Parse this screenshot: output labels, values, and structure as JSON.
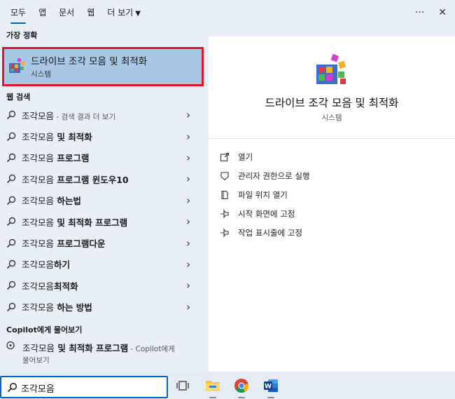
{
  "tabs": [
    {
      "label": "모두",
      "active": true
    },
    {
      "label": "앱"
    },
    {
      "label": "문서"
    },
    {
      "label": "웹"
    },
    {
      "label": "더 보기"
    }
  ],
  "top_right": {
    "more": "···",
    "close": "✕"
  },
  "best_match": {
    "section": "가장 정확",
    "title": "드라이브 조각 모음 및 최적화",
    "subtitle": "시스템"
  },
  "web_search": {
    "section": "웹 검색",
    "items": [
      {
        "query": "조각모음",
        "suffix": " - 검색 결과 더 보기",
        "bold": ""
      },
      {
        "query": "조각모음",
        "bold": " 및 최적화"
      },
      {
        "query": "조각모음",
        "bold": " 프로그램"
      },
      {
        "query": "조각모음",
        "bold": " 프로그램 윈도우10"
      },
      {
        "query": "조각모음",
        "bold": " 하는법"
      },
      {
        "query": "조각모음",
        "bold": " 및 최적화 프로그램"
      },
      {
        "query": "조각모음",
        "bold": " 프로그램다운"
      },
      {
        "query": "조각모음",
        "bold": "하기"
      },
      {
        "query": "조각모음",
        "bold": "최적화"
      },
      {
        "query": "조각모음",
        "bold": " 하는 방법"
      }
    ]
  },
  "copilot": {
    "section": "Copilot에게 물어보기",
    "query": "조각모음",
    "bold": " 및 최적화 프로그램",
    "suffix": " - Copilot에게",
    "line2": "물어보기"
  },
  "detail": {
    "title": "드라이브 조각 모음 및 최적화",
    "subtitle": "시스템",
    "actions": [
      {
        "label": "열기",
        "icon": "open-icon"
      },
      {
        "label": "관리자 권한으로 실행",
        "icon": "shield-icon"
      },
      {
        "label": "파일 위치 열기",
        "icon": "file-location-icon"
      },
      {
        "label": "시작 화면에 고정",
        "icon": "pin-icon"
      },
      {
        "label": "작업 표시줄에 고정",
        "icon": "pin-icon"
      }
    ]
  },
  "taskbar": {
    "search_value": "조각모음",
    "icons": [
      "task-view-icon",
      "file-explorer-icon",
      "chrome-icon",
      "word-icon"
    ]
  },
  "colors": {
    "accent": "#0067c0",
    "highlight": "#a9c8e6",
    "outline": "#e0142b"
  }
}
